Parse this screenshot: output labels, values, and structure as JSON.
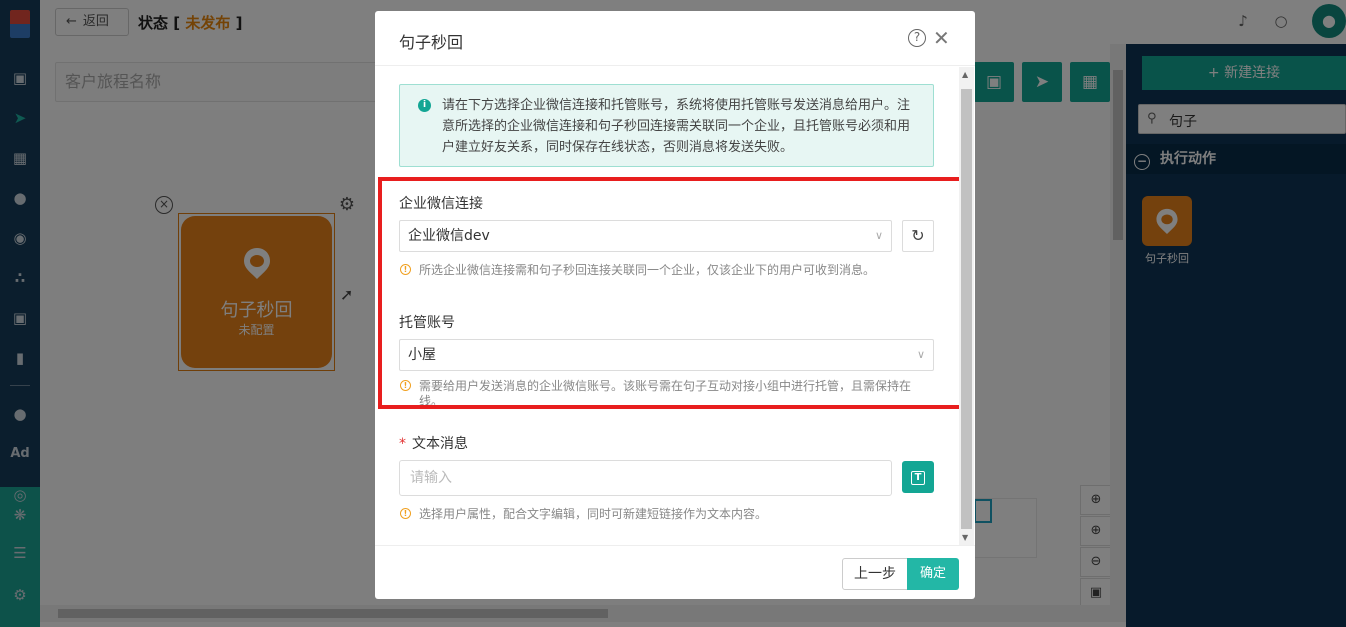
{
  "topbar": {
    "back_label": "返回",
    "status_label": "状态",
    "status_value": "未发布"
  },
  "journey_name_placeholder": "客户旅程名称",
  "sidebar": {
    "items": [
      "dashboard-icon",
      "send-icon",
      "layout-icon",
      "user-icon",
      "users-icon",
      "cluster-icon",
      "bookmark-icon",
      "chart-icon",
      "wechat-icon",
      "ad-text",
      "target-icon",
      "network-icon",
      "server-icon",
      "settings-icon"
    ],
    "ad_text": "Ad"
  },
  "canvas": {
    "node": {
      "name": "句子秒回",
      "status": "未配置",
      "color": "#e8821a"
    }
  },
  "right_panel": {
    "new_connection_label": "新建连接",
    "search_value": "句子",
    "category": "执行动作",
    "items": [
      {
        "label": "句子秒回"
      }
    ]
  },
  "modal": {
    "title": "句子秒回",
    "info": "请在下方选择企业微信连接和托管账号，系统将使用托管账号发送消息给用户。注意所选择的企业微信连接和句子秒回连接需关联同一个企业，且托管账号必须和用户建立好友关系，同时保存在线状态，否则消息将发送失败。",
    "fields": {
      "wecom_connection": {
        "label": "企业微信连接",
        "value": "企业微信dev",
        "hint": "所选企业微信连接需和句子秒回连接关联同一个企业，仅该企业下的用户可收到消息。"
      },
      "hosted_account": {
        "label": "托管账号",
        "value": "小屋",
        "hint": "需要给用户发送消息的企业微信账号。该账号需在句子互动对接小组中进行托管，且需保持在线。"
      },
      "text_message": {
        "required_mark": "*",
        "label": "文本消息",
        "placeholder": "请输入",
        "hint": "选择用户属性，配合文字编辑，同时可新建短链接作为文本内容。"
      }
    },
    "prev_label": "上一步",
    "confirm_label": "确定"
  },
  "colors": {
    "accent": "#13a694",
    "sidebar_bg": "#173d5b",
    "highlight": "#e81e1e",
    "warning": "#f0a020"
  }
}
